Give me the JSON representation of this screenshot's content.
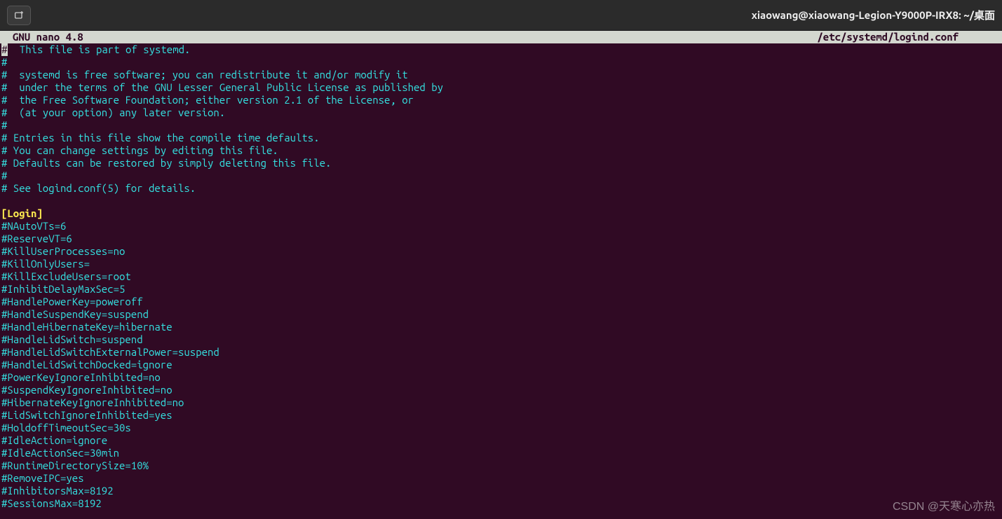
{
  "window": {
    "title": "xiaowang@xiaowang-Legion-Y9000P-IRX8: ~/桌面"
  },
  "nano": {
    "app_name": "GNU nano 4.8",
    "file_path": "/etc/systemd/logind.conf"
  },
  "file_lines": [
    {
      "t": "comment_first",
      "text": "  This file is part of systemd."
    },
    {
      "t": "comment",
      "text": "#"
    },
    {
      "t": "comment",
      "text": "#  systemd is free software; you can redistribute it and/or modify it"
    },
    {
      "t": "comment",
      "text": "#  under the terms of the GNU Lesser General Public License as published by"
    },
    {
      "t": "comment",
      "text": "#  the Free Software Foundation; either version 2.1 of the License, or"
    },
    {
      "t": "comment",
      "text": "#  (at your option) any later version."
    },
    {
      "t": "comment",
      "text": "#"
    },
    {
      "t": "comment",
      "text": "# Entries in this file show the compile time defaults."
    },
    {
      "t": "comment",
      "text": "# You can change settings by editing this file."
    },
    {
      "t": "comment",
      "text": "# Defaults can be restored by simply deleting this file."
    },
    {
      "t": "comment",
      "text": "#"
    },
    {
      "t": "comment",
      "text": "# See logind.conf(5) for details."
    },
    {
      "t": "blank",
      "text": ""
    },
    {
      "t": "section",
      "text": "[Login]"
    },
    {
      "t": "comment",
      "text": "#NAutoVTs=6"
    },
    {
      "t": "comment",
      "text": "#ReserveVT=6"
    },
    {
      "t": "comment",
      "text": "#KillUserProcesses=no"
    },
    {
      "t": "comment",
      "text": "#KillOnlyUsers="
    },
    {
      "t": "comment",
      "text": "#KillExcludeUsers=root"
    },
    {
      "t": "comment",
      "text": "#InhibitDelayMaxSec=5"
    },
    {
      "t": "comment",
      "text": "#HandlePowerKey=poweroff"
    },
    {
      "t": "comment",
      "text": "#HandleSuspendKey=suspend"
    },
    {
      "t": "comment",
      "text": "#HandleHibernateKey=hibernate"
    },
    {
      "t": "comment",
      "text": "#HandleLidSwitch=suspend"
    },
    {
      "t": "comment",
      "text": "#HandleLidSwitchExternalPower=suspend"
    },
    {
      "t": "comment",
      "text": "#HandleLidSwitchDocked=ignore"
    },
    {
      "t": "comment",
      "text": "#PowerKeyIgnoreInhibited=no"
    },
    {
      "t": "comment",
      "text": "#SuspendKeyIgnoreInhibited=no"
    },
    {
      "t": "comment",
      "text": "#HibernateKeyIgnoreInhibited=no"
    },
    {
      "t": "comment",
      "text": "#LidSwitchIgnoreInhibited=yes"
    },
    {
      "t": "comment",
      "text": "#HoldoffTimeoutSec=30s"
    },
    {
      "t": "comment",
      "text": "#IdleAction=ignore"
    },
    {
      "t": "comment",
      "text": "#IdleActionSec=30min"
    },
    {
      "t": "comment",
      "text": "#RuntimeDirectorySize=10%"
    },
    {
      "t": "comment",
      "text": "#RemoveIPC=yes"
    },
    {
      "t": "comment",
      "text": "#InhibitorsMax=8192"
    },
    {
      "t": "comment",
      "text": "#SessionsMax=8192"
    }
  ],
  "watermark": "CSDN @天寒心亦热"
}
